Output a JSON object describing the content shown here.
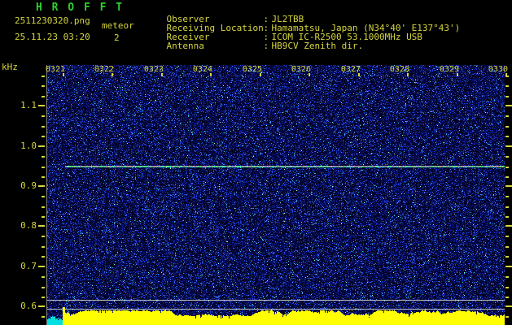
{
  "app": {
    "title": "H R O F F T"
  },
  "header": {
    "filename": "2511230320.png",
    "mode": "meteor",
    "datetime": "25.11.23 03:20",
    "count": "2",
    "separator": ":",
    "info_rows": [
      {
        "label": "Observer",
        "value": "JL2TBB"
      },
      {
        "label": "Receiving Location",
        "value": "Hamamatsu, Japan (N34°40' E137°43')"
      },
      {
        "label": "Receiver",
        "value": "ICOM IC-R2500 53.1000MHz USB"
      },
      {
        "label": "Antenna",
        "value": "HB9CV Zenith dir."
      }
    ]
  },
  "chart_data": {
    "type": "heatmap",
    "title": "HROFFT radio meteor spectrogram",
    "ylabel": "kHz",
    "y_tick_labels": [
      "1.1",
      "1.0",
      "0.9",
      "0.8",
      "0.7",
      "0.6"
    ],
    "y_tick_khz": [
      1.1,
      1.0,
      0.9,
      0.8,
      0.7,
      0.6
    ],
    "ylim_khz": [
      0.58,
      1.2
    ],
    "x_tick_labels": [
      "0321",
      "0322",
      "0323",
      "0324",
      "0325",
      "0326",
      "0327",
      "0328",
      "0329",
      "0330"
    ],
    "grid": "two horizontal gray reference lines near 0.62 and 0.59 kHz",
    "legend_position": "none",
    "series": [
      {
        "name": "background-noise",
        "description": "random blue speckle noise filling plot"
      },
      {
        "name": "carrier-line",
        "khz": 0.95,
        "start_time": "0321",
        "end_time": "0330",
        "description": "continuous green/magenta carrier trace across full width"
      },
      {
        "name": "signal-strength-strip",
        "description": "yellow power graph along bottom edge from 0321 onward; cyan low-level segment before 0321 with spike at transition"
      }
    ]
  },
  "colors": {
    "background": "#000000",
    "title_green": "#2fcf2f",
    "label_yellow": "#d6d63e",
    "waveform_yellow": "#ffff00",
    "waveform_cyan": "#00e0e0",
    "grid_gray": "#c0c4cc",
    "carrier_magenta": "#c850aa",
    "carrier_green": "#32d27a",
    "noise_palette": [
      "#020222",
      "#040840",
      "#080e64",
      "#101a8c",
      "#1830b4",
      "#2446e6",
      "#4682ff",
      "#32c8dc",
      "#8cffc8"
    ]
  }
}
